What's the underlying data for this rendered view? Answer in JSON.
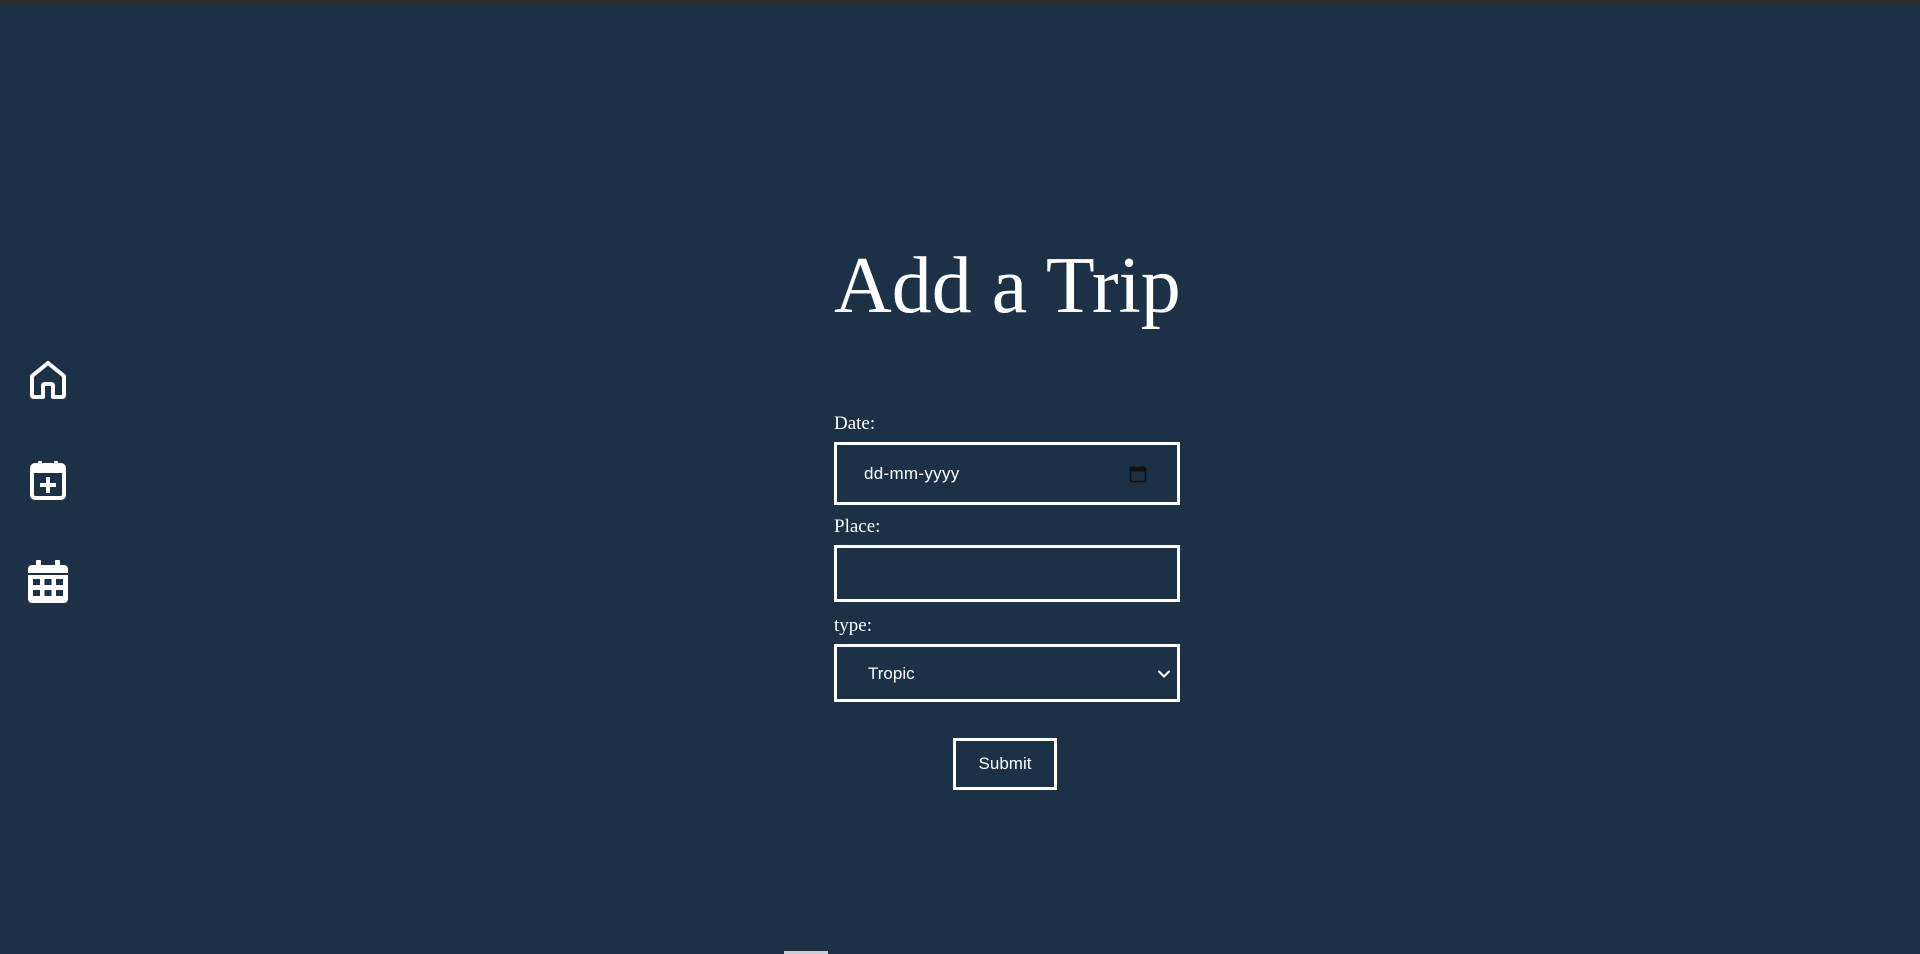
{
  "page": {
    "title": "Add a Trip"
  },
  "sidebar": {
    "items": [
      {
        "icon": "home-icon"
      },
      {
        "icon": "calendar-plus-icon"
      },
      {
        "icon": "calendar-grid-icon"
      }
    ]
  },
  "form": {
    "date": {
      "label": "Date:",
      "placeholder": "dd-mm-yyyy",
      "icon": "calendar-picker-icon"
    },
    "place": {
      "label": "Place:",
      "value": ""
    },
    "type": {
      "label": "type:",
      "selected": "Tropic"
    },
    "submit_label": "Submit"
  },
  "colors": {
    "background": "#1c3146",
    "foreground": "#ffffff",
    "topbar": "#2e2e2e"
  }
}
